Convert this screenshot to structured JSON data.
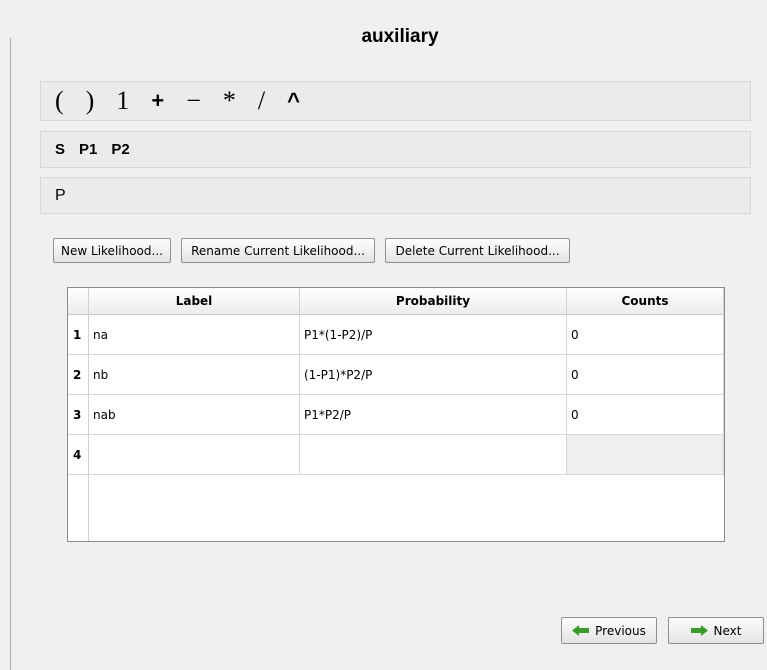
{
  "title": "auxiliary",
  "operators": [
    "(",
    ")",
    "1",
    "+",
    "−",
    "*",
    "/",
    "^"
  ],
  "variables": [
    "S",
    "P1",
    "P2"
  ],
  "expression": "P",
  "buttons": {
    "new_likelihood": "New Likelihood...",
    "rename_likelihood": "Rename Current Likelihood...",
    "delete_likelihood": "Delete Current Likelihood..."
  },
  "table": {
    "headers": [
      "Label",
      "Probability",
      "Counts"
    ],
    "rows": [
      {
        "num": "1",
        "label": "na",
        "probability": "P1*(1-P2)/P",
        "counts": "0"
      },
      {
        "num": "2",
        "label": "nb",
        "probability": "(1-P1)*P2/P",
        "counts": "0"
      },
      {
        "num": "3",
        "label": "nab",
        "probability": "P1*P2/P",
        "counts": "0"
      },
      {
        "num": "4",
        "label": "",
        "probability": "",
        "counts": ""
      }
    ]
  },
  "nav": {
    "previous": "Previous",
    "next": "Next"
  },
  "colors": {
    "arrow_previous": "#3a9a2e",
    "arrow_next": "#3a9a2e"
  },
  "icons": {
    "previous": "arrow-left-icon",
    "next": "arrow-right-icon"
  }
}
